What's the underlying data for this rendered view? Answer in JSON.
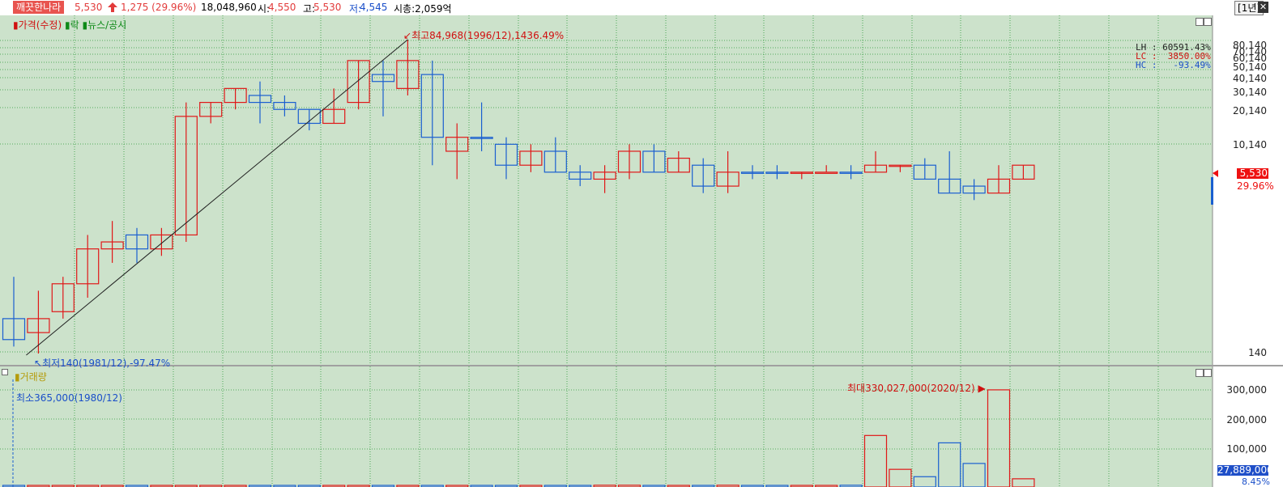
{
  "header": {
    "stock_name": "깨끗한나라",
    "price": "5,530",
    "change": "1,275 (29.96%)",
    "volume": "18,048,960",
    "open_label": "시:",
    "open_value": "4,550",
    "high_label": "고:",
    "high_value": "5,530",
    "low_label": "저:",
    "low_value": "4,545",
    "market_cap": "시총:2,059억",
    "period_button": "1년",
    "close_button": "✕"
  },
  "legend": {
    "price": "가격(수정)",
    "sep": "락",
    "news": "뉴스/공시",
    "volume": "거래량"
  },
  "info_box": {
    "lh": "LH : 60591.43%",
    "lc": "LC :  3850.00%",
    "hc": "HC :   -93.49%"
  },
  "price_axis": {
    "ticks": [
      "80,140",
      "70,140",
      "60,140",
      "50,140",
      "40,140",
      "30,140",
      "20,140",
      "10,140",
      "140"
    ],
    "current_price": "5,530",
    "current_pct": "29.96%"
  },
  "volume_axis": {
    "ticks": [
      "300,000",
      "200,000",
      "100,000"
    ],
    "current_volume": "27,889,000",
    "current_pct": "8.45%"
  },
  "annotations": {
    "max": "최고84,968(1996/12),1436.49%",
    "min": "최저140(1981/12),-97.47%",
    "vol_min": "최소365,000(1980/12)",
    "vol_max": "최대330,027,000(2020/12)"
  },
  "colors": {
    "up": "#e01818",
    "down": "#1a5fd0",
    "background": "#cce2cb",
    "grid": "#2e9a3a"
  },
  "chart_data": {
    "type": "candlestick",
    "period": "yearly",
    "candles": [
      {
        "o": 0.6,
        "h": 0.66,
        "l": 0.56,
        "c": 0.57,
        "dir": "down"
      },
      {
        "o": 0.6,
        "h": 0.64,
        "l": 0.55,
        "c": 0.58,
        "dir": "up"
      },
      {
        "o": 0.61,
        "h": 0.66,
        "l": 0.6,
        "c": 0.65,
        "dir": "up"
      },
      {
        "o": 0.65,
        "h": 0.72,
        "l": 0.63,
        "c": 0.7,
        "dir": "up"
      },
      {
        "o": 0.7,
        "h": 0.74,
        "l": 0.68,
        "c": 0.71,
        "dir": "up"
      },
      {
        "o": 0.72,
        "h": 0.73,
        "l": 0.68,
        "c": 0.7,
        "dir": "down"
      },
      {
        "o": 0.7,
        "h": 0.73,
        "l": 0.69,
        "c": 0.72,
        "dir": "up"
      },
      {
        "o": 0.72,
        "h": 0.91,
        "l": 0.71,
        "c": 0.89,
        "dir": "up"
      },
      {
        "o": 0.89,
        "h": 0.91,
        "l": 0.88,
        "c": 0.91,
        "dir": "up"
      },
      {
        "o": 0.91,
        "h": 0.93,
        "l": 0.9,
        "c": 0.93,
        "dir": "up"
      },
      {
        "o": 0.91,
        "h": 0.94,
        "l": 0.88,
        "c": 0.92,
        "dir": "down"
      },
      {
        "o": 0.91,
        "h": 0.92,
        "l": 0.89,
        "c": 0.9,
        "dir": "down"
      },
      {
        "o": 0.88,
        "h": 0.9,
        "l": 0.87,
        "c": 0.9,
        "dir": "down"
      },
      {
        "o": 0.88,
        "h": 0.93,
        "l": 0.88,
        "c": 0.9,
        "dir": "up"
      },
      {
        "o": 0.91,
        "h": 0.97,
        "l": 0.9,
        "c": 0.97,
        "dir": "up"
      },
      {
        "o": 0.94,
        "h": 0.97,
        "l": 0.89,
        "c": 0.95,
        "dir": "down"
      },
      {
        "o": 0.93,
        "h": 1.0,
        "l": 0.92,
        "c": 0.97,
        "dir": "up"
      },
      {
        "o": 0.95,
        "h": 0.97,
        "l": 0.82,
        "c": 0.86,
        "dir": "down"
      },
      {
        "o": 0.86,
        "h": 0.88,
        "l": 0.8,
        "c": 0.84,
        "dir": "up"
      },
      {
        "o": 0.86,
        "h": 0.91,
        "l": 0.84,
        "c": 0.86,
        "dir": "down"
      },
      {
        "o": 0.85,
        "h": 0.86,
        "l": 0.8,
        "c": 0.82,
        "dir": "down"
      },
      {
        "o": 0.82,
        "h": 0.85,
        "l": 0.81,
        "c": 0.84,
        "dir": "up"
      },
      {
        "o": 0.84,
        "h": 0.86,
        "l": 0.81,
        "c": 0.81,
        "dir": "down"
      },
      {
        "o": 0.81,
        "h": 0.82,
        "l": 0.79,
        "c": 0.8,
        "dir": "down"
      },
      {
        "o": 0.8,
        "h": 0.82,
        "l": 0.78,
        "c": 0.81,
        "dir": "up"
      },
      {
        "o": 0.81,
        "h": 0.85,
        "l": 0.8,
        "c": 0.84,
        "dir": "up"
      },
      {
        "o": 0.84,
        "h": 0.85,
        "l": 0.81,
        "c": 0.81,
        "dir": "down"
      },
      {
        "o": 0.81,
        "h": 0.84,
        "l": 0.81,
        "c": 0.83,
        "dir": "up"
      },
      {
        "o": 0.82,
        "h": 0.83,
        "l": 0.78,
        "c": 0.79,
        "dir": "down"
      },
      {
        "o": 0.79,
        "h": 0.84,
        "l": 0.78,
        "c": 0.81,
        "dir": "up"
      },
      {
        "o": 0.81,
        "h": 0.82,
        "l": 0.8,
        "c": 0.81,
        "dir": "down"
      },
      {
        "o": 0.81,
        "h": 0.82,
        "l": 0.8,
        "c": 0.81,
        "dir": "down"
      },
      {
        "o": 0.81,
        "h": 0.81,
        "l": 0.8,
        "c": 0.81,
        "dir": "up"
      },
      {
        "o": 0.81,
        "h": 0.82,
        "l": 0.81,
        "c": 0.81,
        "dir": "up"
      },
      {
        "o": 0.81,
        "h": 0.82,
        "l": 0.8,
        "c": 0.81,
        "dir": "down"
      },
      {
        "o": 0.81,
        "h": 0.84,
        "l": 0.81,
        "c": 0.82,
        "dir": "up"
      },
      {
        "o": 0.82,
        "h": 0.82,
        "l": 0.81,
        "c": 0.82,
        "dir": "up"
      },
      {
        "o": 0.82,
        "h": 0.83,
        "l": 0.8,
        "c": 0.8,
        "dir": "down"
      },
      {
        "o": 0.8,
        "h": 0.84,
        "l": 0.78,
        "c": 0.78,
        "dir": "down"
      },
      {
        "o": 0.79,
        "h": 0.8,
        "l": 0.77,
        "c": 0.78,
        "dir": "down"
      },
      {
        "o": 0.78,
        "h": 0.82,
        "l": 0.78,
        "c": 0.8,
        "dir": "up"
      },
      {
        "o": 0.8,
        "h": 0.82,
        "l": 0.8,
        "c": 0.82,
        "dir": "up"
      }
    ],
    "volume": [
      {
        "v": 0,
        "dir": "down"
      },
      {
        "v": 0,
        "dir": "up"
      },
      {
        "v": 0,
        "dir": "up"
      },
      {
        "v": 0,
        "dir": "up"
      },
      {
        "v": 0,
        "dir": "up"
      },
      {
        "v": 0,
        "dir": "down"
      },
      {
        "v": 0,
        "dir": "up"
      },
      {
        "v": 1000000,
        "dir": "up"
      },
      {
        "v": 0,
        "dir": "up"
      },
      {
        "v": 0,
        "dir": "up"
      },
      {
        "v": 0,
        "dir": "down"
      },
      {
        "v": 0,
        "dir": "down"
      },
      {
        "v": 0,
        "dir": "down"
      },
      {
        "v": 0,
        "dir": "up"
      },
      {
        "v": 0,
        "dir": "up"
      },
      {
        "v": 0,
        "dir": "down"
      },
      {
        "v": 2000000,
        "dir": "up"
      },
      {
        "v": 1000000,
        "dir": "down"
      },
      {
        "v": 0,
        "dir": "up"
      },
      {
        "v": 2000000,
        "dir": "down"
      },
      {
        "v": 1000000,
        "dir": "down"
      },
      {
        "v": 2000000,
        "dir": "up"
      },
      {
        "v": 1000000,
        "dir": "down"
      },
      {
        "v": 0,
        "dir": "down"
      },
      {
        "v": 6000000,
        "dir": "up"
      },
      {
        "v": 6000000,
        "dir": "up"
      },
      {
        "v": 3000000,
        "dir": "down"
      },
      {
        "v": 2000000,
        "dir": "up"
      },
      {
        "v": 3000000,
        "dir": "down"
      },
      {
        "v": 6000000,
        "dir": "up"
      },
      {
        "v": 2000000,
        "dir": "down"
      },
      {
        "v": 4000000,
        "dir": "down"
      },
      {
        "v": 2000000,
        "dir": "up"
      },
      {
        "v": 2000000,
        "dir": "up"
      },
      {
        "v": 6000000,
        "dir": "down"
      },
      {
        "v": 175000000,
        "dir": "up"
      },
      {
        "v": 60000000,
        "dir": "up"
      },
      {
        "v": 35000000,
        "dir": "down"
      },
      {
        "v": 150000000,
        "dir": "down"
      },
      {
        "v": 80000000,
        "dir": "down"
      },
      {
        "v": 330027000,
        "dir": "up"
      },
      {
        "v": 27889000,
        "dir": "up"
      }
    ],
    "vol_max": 360000000,
    "series": [
      {
        "name": "가격(수정)"
      },
      {
        "name": "거래량"
      }
    ]
  }
}
